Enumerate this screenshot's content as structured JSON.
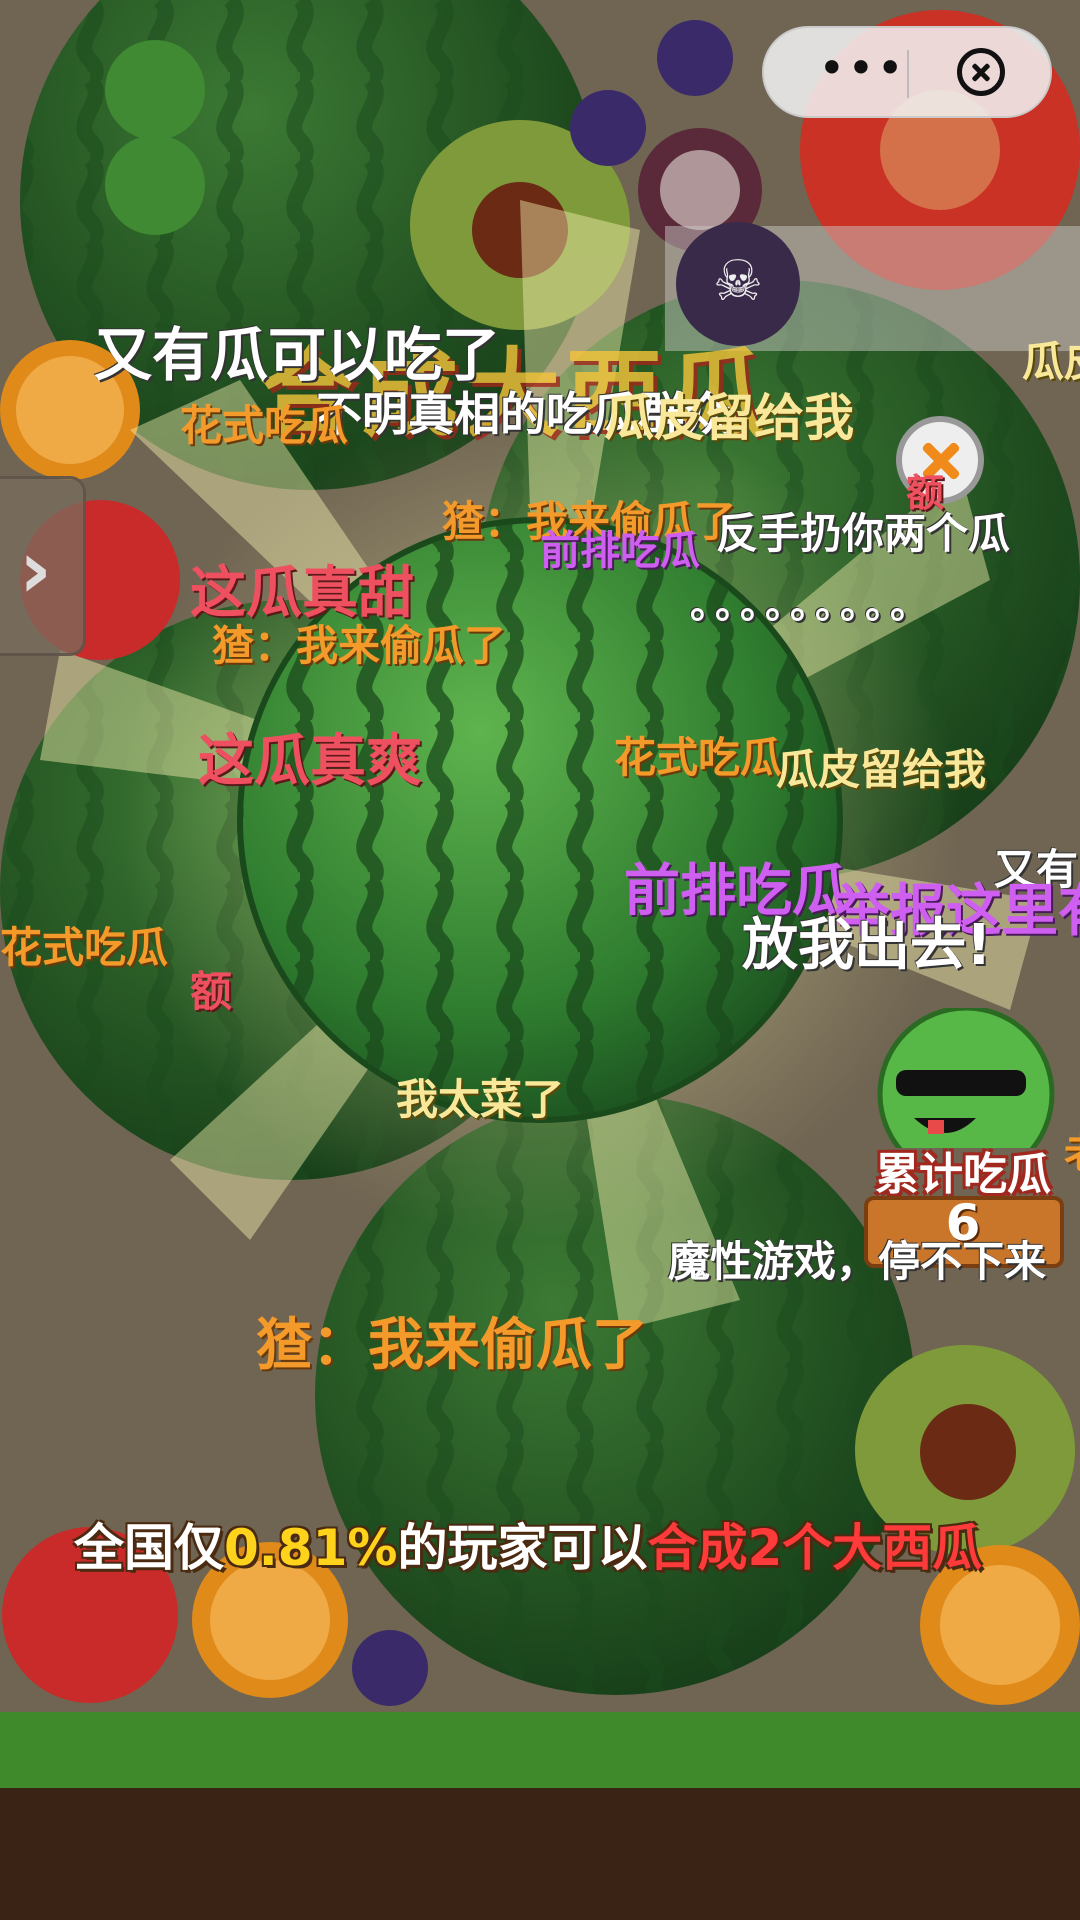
{
  "colors": {
    "background": "#6f6552",
    "watermelon_dark": "#1f5a22",
    "watermelon_light": "#4aa048",
    "grass": "#3f8a2a",
    "soil": "#3a2314",
    "highlight_yellow": "#ffd21c",
    "highlight_red": "#ff3a3a"
  },
  "capsule_menu": {
    "more_icon": "more-dots-icon",
    "more_text": "•••",
    "close_icon": "close-circle-icon"
  },
  "side_tab": {
    "icon": "chevron-right-icon",
    "glyph": "›"
  },
  "game": {
    "title": "合成大西瓜"
  },
  "counter_badge": {
    "label": "累计吃瓜",
    "count": "6"
  },
  "banner": {
    "prefix": "全国仅",
    "percent": "0.81%",
    "middle": "的玩家可以",
    "goal": "合成2个大西瓜"
  },
  "danmaku": [
    {
      "text": "又有瓜可以吃了"
    },
    {
      "text": "不明真相的吃瓜群众"
    },
    {
      "text": "瓜皮留给我"
    },
    {
      "text": "花式吃瓜"
    },
    {
      "text": "瓜皮"
    },
    {
      "text": "猹：我来偷瓜了"
    },
    {
      "text": "前排吃瓜"
    },
    {
      "text": "反手扔你两个瓜"
    },
    {
      "text": "额"
    },
    {
      "text": "这瓜真甜"
    },
    {
      "text": "猹：我来偷瓜了"
    },
    {
      "text": "。。。。。。。。。"
    },
    {
      "text": "这瓜真爽"
    },
    {
      "text": "花式吃瓜"
    },
    {
      "text": "瓜皮留给我"
    },
    {
      "text": "又有"
    },
    {
      "text": "前排吃瓜"
    },
    {
      "text": "举报这里有"
    },
    {
      "text": "放我出去!"
    },
    {
      "text": "花式吃瓜"
    },
    {
      "text": "额"
    },
    {
      "text": "我太菜了"
    },
    {
      "text": "魔性游戏，停不下来"
    },
    {
      "text": "猹：我来偷瓜了"
    },
    {
      "text": "老"
    }
  ]
}
